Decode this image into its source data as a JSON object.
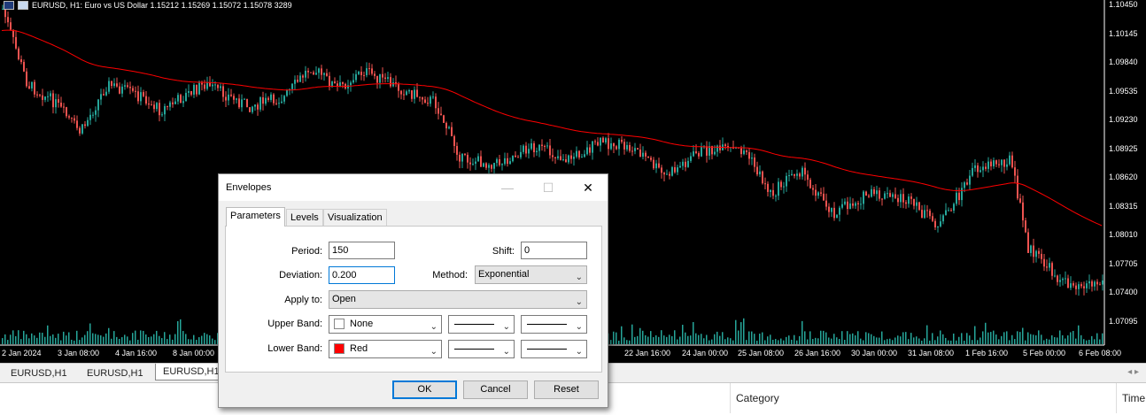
{
  "chart": {
    "header_text": "EURUSD, H1:  Euro vs US Dollar  1.15212 1.15269 1.15072 1.15078  3289",
    "price_labels": [
      "1.10450",
      "1.10145",
      "1.09840",
      "1.09535",
      "1.09230",
      "1.08925",
      "1.08620",
      "1.08315",
      "1.08010",
      "1.07705",
      "1.07400",
      "1.07095"
    ],
    "time_labels": [
      "2 Jan 2024",
      "3 Jan 08:00",
      "4 Jan 16:00",
      "8 Jan 00:00",
      "22 Jan 16:00",
      "24 Jan 00:00",
      "25 Jan 08:00",
      "26 Jan 16:00",
      "30 Jan 00:00",
      "31 Jan 08:00",
      "1 Feb 16:00",
      "5 Feb 00:00",
      "6 Feb 08:00"
    ],
    "colors": {
      "bull": "#26a69a",
      "bear": "#ef5350",
      "envelope": "#ff0000",
      "background": "#000000"
    }
  },
  "chart_tabs": [
    "EURUSD,H1",
    "EURUSD,H1",
    "EURUSD,H1"
  ],
  "tab_arrows": "◂ ▸",
  "bottom_panel": {
    "columns": [
      "Category",
      "Time"
    ]
  },
  "dialog": {
    "title": "Envelopes",
    "window_buttons": {
      "minimize": "—",
      "maximize": "☐",
      "close": "✕"
    },
    "tabs": [
      "Parameters",
      "Levels",
      "Visualization"
    ],
    "period_label": "Period:",
    "period_value": "150",
    "shift_label": "Shift:",
    "shift_value": "0",
    "deviation_label": "Deviation:",
    "deviation_value": "0.200",
    "method_label": "Method:",
    "method_value": "Exponential",
    "apply_label": "Apply to:",
    "apply_value": "Open",
    "upper_label": "Upper Band:",
    "upper_color_name": "None",
    "upper_color": "#ffffff",
    "lower_label": "Lower Band:",
    "lower_color_name": "Red",
    "lower_color": "#ff0000",
    "ok": "OK",
    "cancel": "Cancel",
    "reset": "Reset"
  }
}
